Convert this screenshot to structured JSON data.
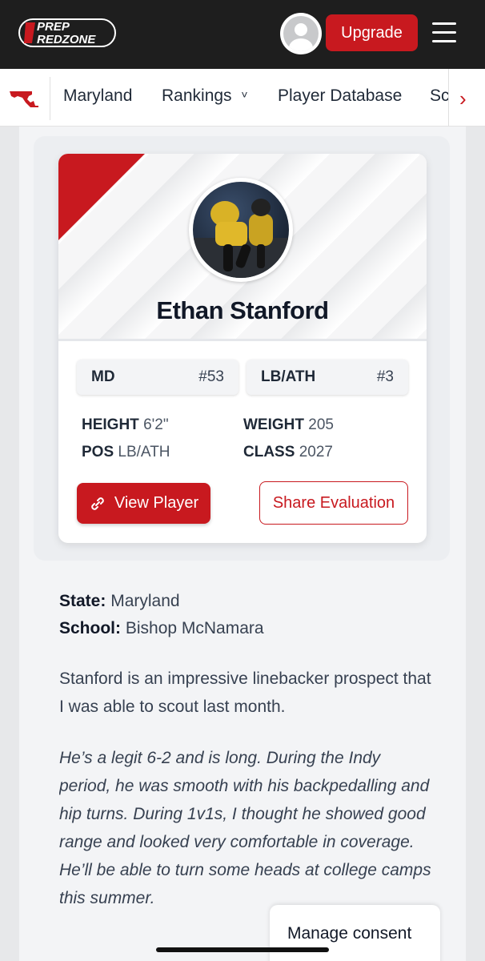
{
  "header": {
    "logo_line1": "PREP",
    "logo_line2": "REDZONE",
    "upgrade_label": "Upgrade"
  },
  "nav": {
    "items": [
      "Maryland",
      "Rankings",
      "Player Database",
      "Sc"
    ],
    "rankings_chevron": "˅",
    "scroll_arrow": "›"
  },
  "player": {
    "name": "Ethan Stanford",
    "state_abbr": "MD",
    "state_rank": "#53",
    "position_label": "LB/ATH",
    "position_rank": "#3",
    "height_label": "HEIGHT",
    "height": "6'2\"",
    "weight_label": "WEIGHT",
    "weight": "205",
    "pos_label": "POS",
    "pos": "LB/ATH",
    "class_label": "CLASS",
    "class": "2027",
    "view_label": "View Player",
    "share_label": "Share Evaluation"
  },
  "article": {
    "state_label": "State:",
    "state": "Maryland",
    "school_label": "School:",
    "school": "Bishop McNamara",
    "p1": "Stanford is an impressive linebacker prospect that I was able to scout last month.",
    "p2": "He’s a legit 6-2 and is long. During the Indy period, he was smooth with his backpedalling and hip turns. During 1v1s, I thought he showed good range and looked very comfortable in coverage. He’ll be able to turn some heads at college camps this summer."
  },
  "consent": {
    "label": "Manage consent"
  },
  "colors": {
    "brand_red": "#c8191f",
    "header_bg": "#1e1e1e"
  },
  "icons": [
    "avatar-icon",
    "menu-icon",
    "maryland-state-icon",
    "chevron-down-icon",
    "chevron-right-icon",
    "link-icon"
  ]
}
